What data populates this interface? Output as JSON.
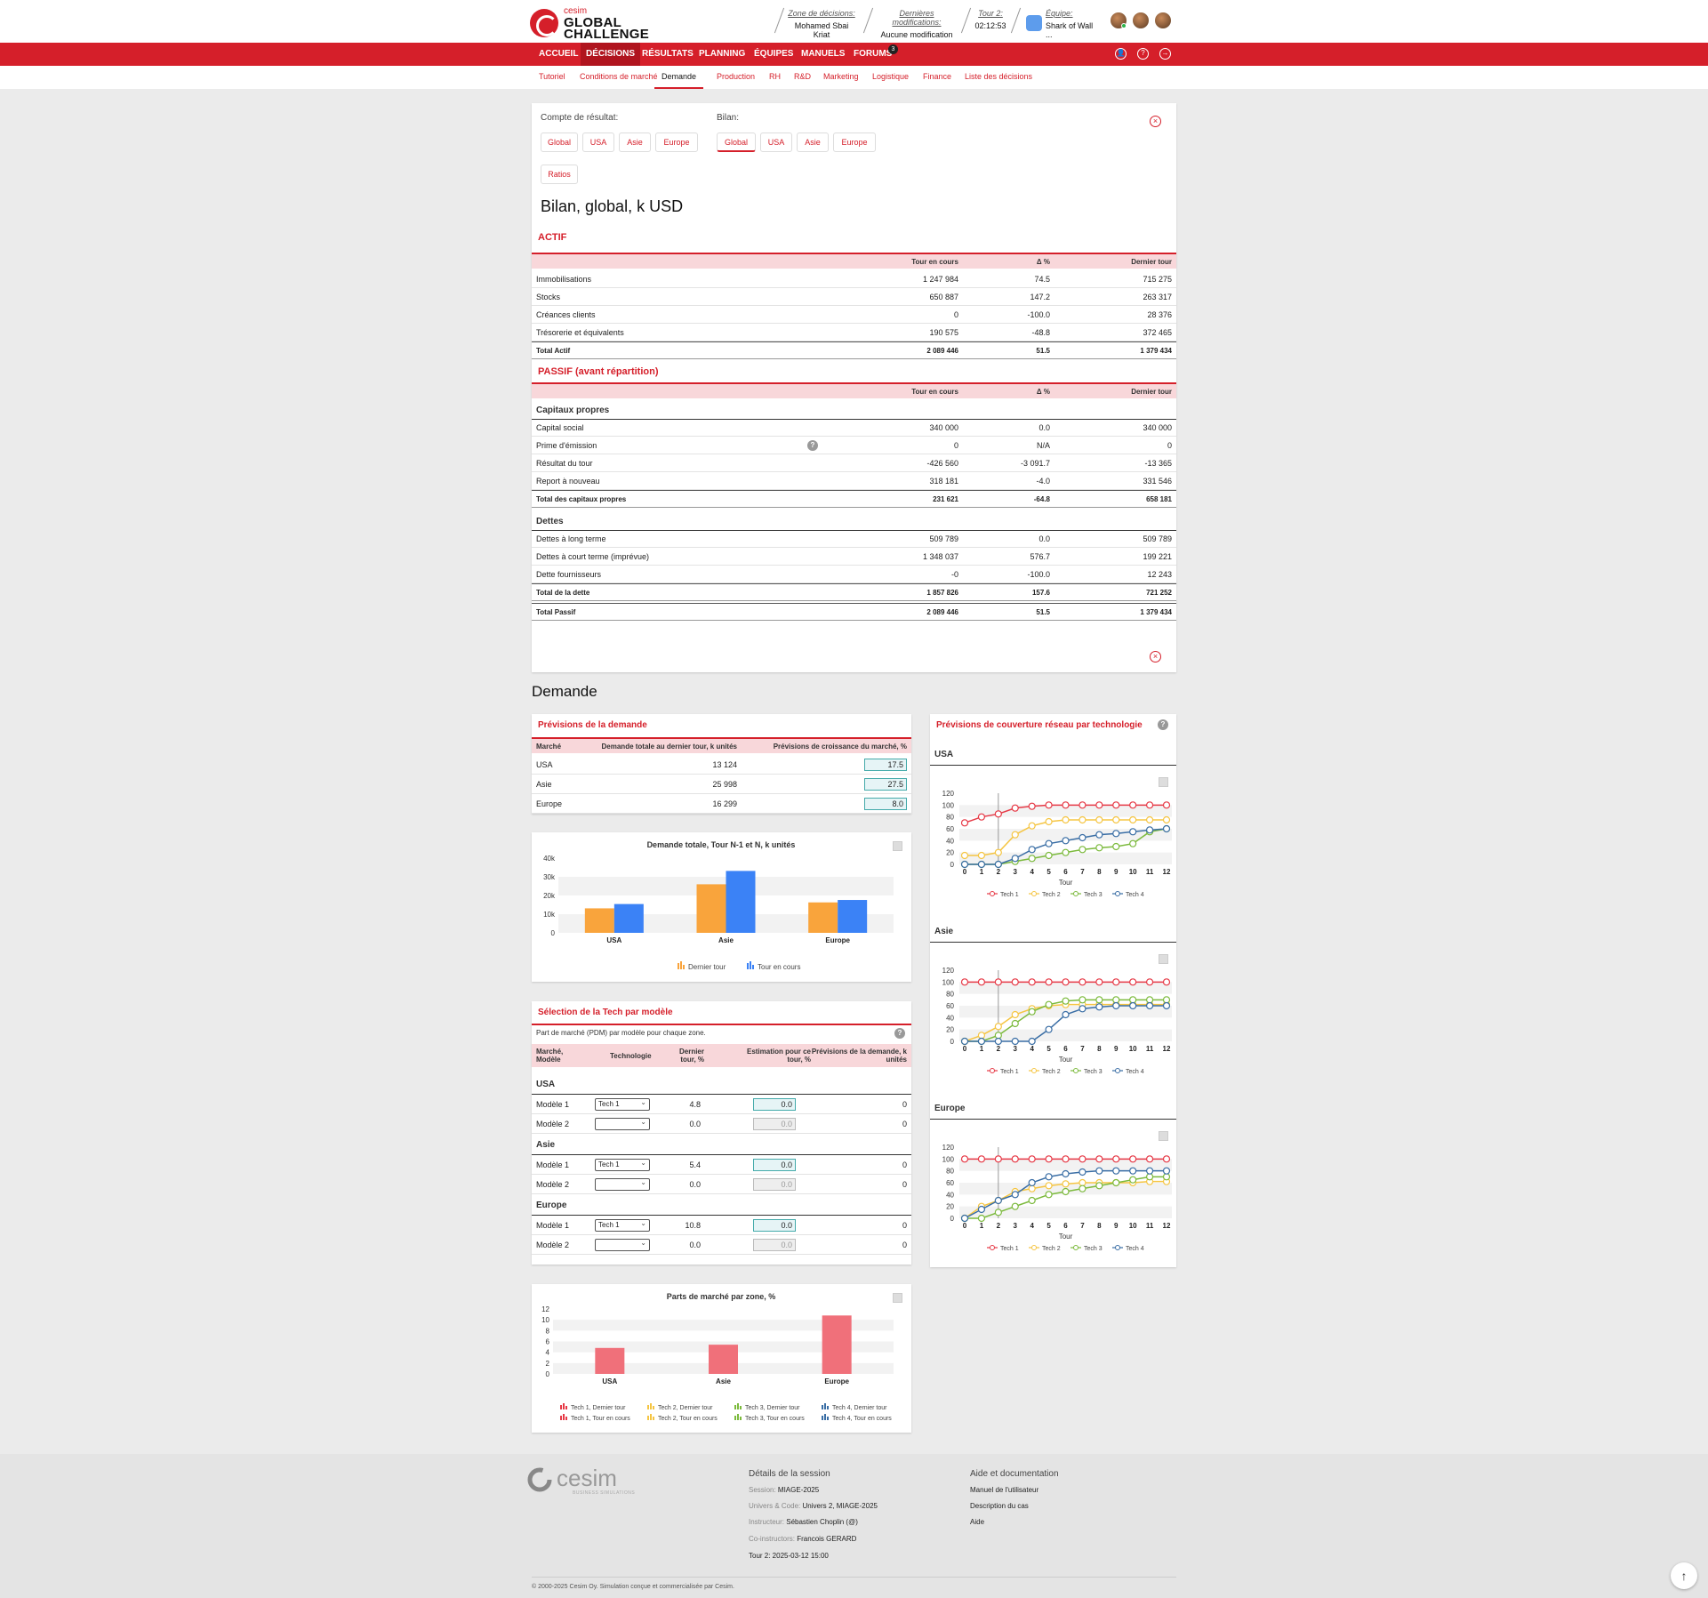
{
  "header": {
    "logo_small": "cesim",
    "logo_line1": "GLOBAL",
    "logo_line2": "CHALLENGE",
    "zone_label": "Zone de décisions:",
    "zone_value": "Mohamed Sbai Kriat",
    "modif_label": "Dernières modifications:",
    "modif_value": "Aucune modification",
    "tour_label": "Tour 2:",
    "tour_value": "02:12:53",
    "team_label": "Équipe:",
    "team_value": "Shark of Wall ..."
  },
  "nav": {
    "items": [
      "ACCUEIL",
      "DÉCISIONS",
      "RÉSULTATS",
      "PLANNING",
      "ÉQUIPES",
      "MANUELS",
      "FORUMS"
    ],
    "forums_badge": "3"
  },
  "subnav": {
    "items": [
      "Tutoriel",
      "Conditions de marché",
      "Demande",
      "Production",
      "RH",
      "R&D",
      "Marketing",
      "Logistique",
      "Finance",
      "Liste des décisions"
    ]
  },
  "report": {
    "compte_label": "Compte de résultat:",
    "bilan_label": "Bilan:",
    "compte_buttons": [
      "Global",
      "USA",
      "Asie",
      "Europe",
      "Ratios"
    ],
    "bilan_buttons": [
      "Global",
      "USA",
      "Asie",
      "Europe"
    ],
    "title": "Bilan, global, k USD",
    "actif_title": "ACTIF",
    "passif_title": "PASSIF (avant répartition)",
    "cols": [
      "Tour en cours",
      "Δ %",
      "Dernier tour"
    ],
    "actif_rows": [
      [
        "Immobilisations",
        "1 247 984",
        "74.5",
        "715 275"
      ],
      [
        "Stocks",
        "650 887",
        "147.2",
        "263 317"
      ],
      [
        "Créances clients",
        "0",
        "-100.0",
        "28 376"
      ],
      [
        "Trésorerie et équivalents",
        "190 575",
        "-48.8",
        "372 465"
      ]
    ],
    "actif_total": [
      "Total Actif",
      "2 089 446",
      "51.5",
      "1 379 434"
    ],
    "capitaux_title": "Capitaux propres",
    "capitaux_rows": [
      [
        "Capital social",
        "340 000",
        "0.0",
        "340 000"
      ],
      [
        "Prime d'émission",
        "0",
        "N/A",
        "0"
      ],
      [
        "Résultat du tour",
        "-426 560",
        "-3 091.7",
        "-13 365"
      ],
      [
        "Report à nouveau",
        "318 181",
        "-4.0",
        "331 546"
      ]
    ],
    "capitaux_total": [
      "Total des capitaux propres",
      "231 621",
      "-64.8",
      "658 181"
    ],
    "dettes_title": "Dettes",
    "dettes_rows": [
      [
        "Dettes à long terme",
        "509 789",
        "0.0",
        "509 789"
      ],
      [
        "Dettes à court terme (imprévue)",
        "1 348 037",
        "576.7",
        "199 221"
      ],
      [
        "Dette fournisseurs",
        "-0",
        "-100.0",
        "12 243"
      ]
    ],
    "dettes_total": [
      "Total de la dette",
      "1 857 826",
      "157.6",
      "721 252"
    ],
    "passif_total": [
      "Total Passif",
      "2 089 446",
      "51.5",
      "1 379 434"
    ]
  },
  "demande": {
    "title": "Demande",
    "prev_title": "Prévisions de la demande",
    "prev_cols": [
      "Marché",
      "Demande totale au dernier tour, k unités",
      "Prévisions de croissance du marché, %"
    ],
    "prev_rows": [
      [
        "USA",
        "13 124",
        "17.5"
      ],
      [
        "Asie",
        "25 998",
        "27.5"
      ],
      [
        "Europe",
        "16 299",
        "8.0"
      ]
    ],
    "tech_title": "Sélection de la Tech par modèle",
    "tech_desc": "Part de marché (PDM) par modèle pour chaque zone.",
    "tech_cols": [
      "Marché, Modèle",
      "Technologie",
      "Dernier tour, %",
      "Estimation pour ce tour, %",
      "Prévisions de la demande, k unités"
    ],
    "tech_groups": [
      {
        "name": "USA",
        "rows": [
          [
            "Modèle 1",
            "Tech 1",
            "4.8",
            "0.0",
            "0"
          ],
          [
            "Modèle 2",
            "",
            "0.0",
            "0.0",
            "0"
          ]
        ]
      },
      {
        "name": "Asie",
        "rows": [
          [
            "Modèle 1",
            "Tech 1",
            "5.4",
            "0.0",
            "0"
          ],
          [
            "Modèle 2",
            "",
            "0.0",
            "0.0",
            "0"
          ]
        ]
      },
      {
        "name": "Europe",
        "rows": [
          [
            "Modèle 1",
            "Tech 1",
            "10.8",
            "0.0",
            "0"
          ],
          [
            "Modèle 2",
            "",
            "0.0",
            "0.0",
            "0"
          ]
        ]
      }
    ],
    "net_title": "Prévisions de couverture réseau par technologie"
  },
  "chart_data": [
    {
      "type": "bar",
      "title": "Demande totale, Tour N-1 et N, k unités",
      "categories": [
        "USA",
        "Asie",
        "Europe"
      ],
      "series": [
        {
          "name": "Dernier tour",
          "values": [
            13124,
            25998,
            16299
          ],
          "color": "#f9a43c"
        },
        {
          "name": "Tour en cours",
          "values": [
            15421,
            33147,
            17603
          ],
          "color": "#3b82f6"
        }
      ],
      "ylim": [
        0,
        40000
      ],
      "yticks": [
        "0",
        "10k",
        "20k",
        "30k",
        "40k"
      ],
      "legend": "bottom"
    },
    {
      "type": "bar",
      "title": "Parts de marché par zone, %",
      "categories": [
        "USA",
        "Asie",
        "Europe"
      ],
      "series": [
        {
          "name": "Tech 1, Dernier tour",
          "values": [
            4.8,
            5.4,
            10.8
          ],
          "color": "#f0707a"
        }
      ],
      "ylim": [
        0,
        12
      ],
      "yticks": [
        "0",
        "2",
        "4",
        "6",
        "8",
        "10",
        "12"
      ],
      "legend_items": [
        "Tech 1, Dernier tour",
        "Tech 2, Dernier tour",
        "Tech 3, Dernier tour",
        "Tech 4, Dernier tour",
        "Tech 1, Tour en cours",
        "Tech 2, Tour en cours",
        "Tech 3, Tour en cours",
        "Tech 4, Tour en cours"
      ],
      "legend_colors": [
        "#e63946",
        "#f5c542",
        "#7cba3d",
        "#3a6ea5",
        "#e63946",
        "#f5c542",
        "#7cba3d",
        "#3a6ea5"
      ],
      "legend": "bottom"
    },
    {
      "type": "line",
      "title": "USA",
      "xlabel": "Tour",
      "x": [
        0,
        1,
        2,
        3,
        4,
        5,
        6,
        7,
        8,
        9,
        10,
        11,
        12
      ],
      "ylim": [
        0,
        120
      ],
      "yticks": [
        "0",
        "20",
        "40",
        "60",
        "80",
        "100",
        "120"
      ],
      "series": [
        {
          "name": "Tech 1",
          "values": [
            70,
            80,
            85,
            95,
            98,
            100,
            100,
            100,
            100,
            100,
            100,
            100,
            100
          ],
          "color": "#e63946"
        },
        {
          "name": "Tech 2",
          "values": [
            15,
            15,
            20,
            50,
            65,
            72,
            75,
            75,
            75,
            75,
            75,
            75,
            75
          ],
          "color": "#f5c542"
        },
        {
          "name": "Tech 3",
          "values": [
            0,
            0,
            0,
            5,
            10,
            15,
            20,
            25,
            28,
            30,
            35,
            55,
            60
          ],
          "color": "#7cba3d"
        },
        {
          "name": "Tech 4",
          "values": [
            0,
            0,
            0,
            10,
            25,
            35,
            40,
            45,
            50,
            52,
            55,
            58,
            60
          ],
          "color": "#3a6ea5"
        }
      ]
    },
    {
      "type": "line",
      "title": "Asie",
      "xlabel": "Tour",
      "x": [
        0,
        1,
        2,
        3,
        4,
        5,
        6,
        7,
        8,
        9,
        10,
        11,
        12
      ],
      "ylim": [
        0,
        120
      ],
      "yticks": [
        "0",
        "20",
        "40",
        "60",
        "80",
        "100",
        "120"
      ],
      "series": [
        {
          "name": "Tech 1",
          "values": [
            100,
            100,
            100,
            100,
            100,
            100,
            100,
            100,
            100,
            100,
            100,
            100,
            100
          ],
          "color": "#e63946"
        },
        {
          "name": "Tech 2",
          "values": [
            0,
            10,
            25,
            45,
            55,
            60,
            62,
            62,
            62,
            62,
            62,
            62,
            62
          ],
          "color": "#f5c542"
        },
        {
          "name": "Tech 3",
          "values": [
            0,
            0,
            10,
            30,
            50,
            62,
            68,
            70,
            70,
            70,
            70,
            70,
            70
          ],
          "color": "#7cba3d"
        },
        {
          "name": "Tech 4",
          "values": [
            0,
            0,
            0,
            0,
            0,
            20,
            45,
            55,
            58,
            60,
            60,
            60,
            60
          ],
          "color": "#3a6ea5"
        }
      ]
    },
    {
      "type": "line",
      "title": "Europe",
      "xlabel": "Tour",
      "x": [
        0,
        1,
        2,
        3,
        4,
        5,
        6,
        7,
        8,
        9,
        10,
        11,
        12
      ],
      "ylim": [
        0,
        120
      ],
      "yticks": [
        "0",
        "20",
        "40",
        "60",
        "80",
        "100",
        "120"
      ],
      "series": [
        {
          "name": "Tech 1",
          "values": [
            100,
            100,
            100,
            100,
            100,
            100,
            100,
            100,
            100,
            100,
            100,
            100,
            100
          ],
          "color": "#e63946"
        },
        {
          "name": "Tech 2",
          "values": [
            0,
            20,
            30,
            45,
            50,
            55,
            58,
            60,
            60,
            60,
            60,
            62,
            62
          ],
          "color": "#f5c542"
        },
        {
          "name": "Tech 3",
          "values": [
            0,
            0,
            10,
            20,
            30,
            40,
            45,
            50,
            55,
            60,
            65,
            70,
            70
          ],
          "color": "#7cba3d"
        },
        {
          "name": "Tech 4",
          "values": [
            0,
            15,
            30,
            40,
            60,
            70,
            75,
            78,
            80,
            80,
            80,
            80,
            80
          ],
          "color": "#3a6ea5"
        }
      ]
    }
  ],
  "footer": {
    "logo": "cesim",
    "logo_sub": "BUSINESS SIMULATIONS",
    "session_head": "Détails de la session",
    "session_label": "Session:",
    "session_value": "MIAGE-2025",
    "univers_label": "Univers & Code:",
    "univers_value": "Univers 2, MIAGE-2025",
    "instructor_label": "Instructeur:",
    "instructor_value": "Sébastien Choplin (@)",
    "coinstr_label": "Co-instructors:",
    "coinstr_value": "Francois GERARD",
    "tour_line": "Tour 2: 2025-03-12 15:00",
    "help_head": "Aide et documentation",
    "help_links": [
      "Manuel de l'utilisateur",
      "Description du cas",
      "Aide"
    ],
    "copyright": "© 2000-2025 Cesim Oy. Simulation conçue et commercialisée par Cesim."
  }
}
